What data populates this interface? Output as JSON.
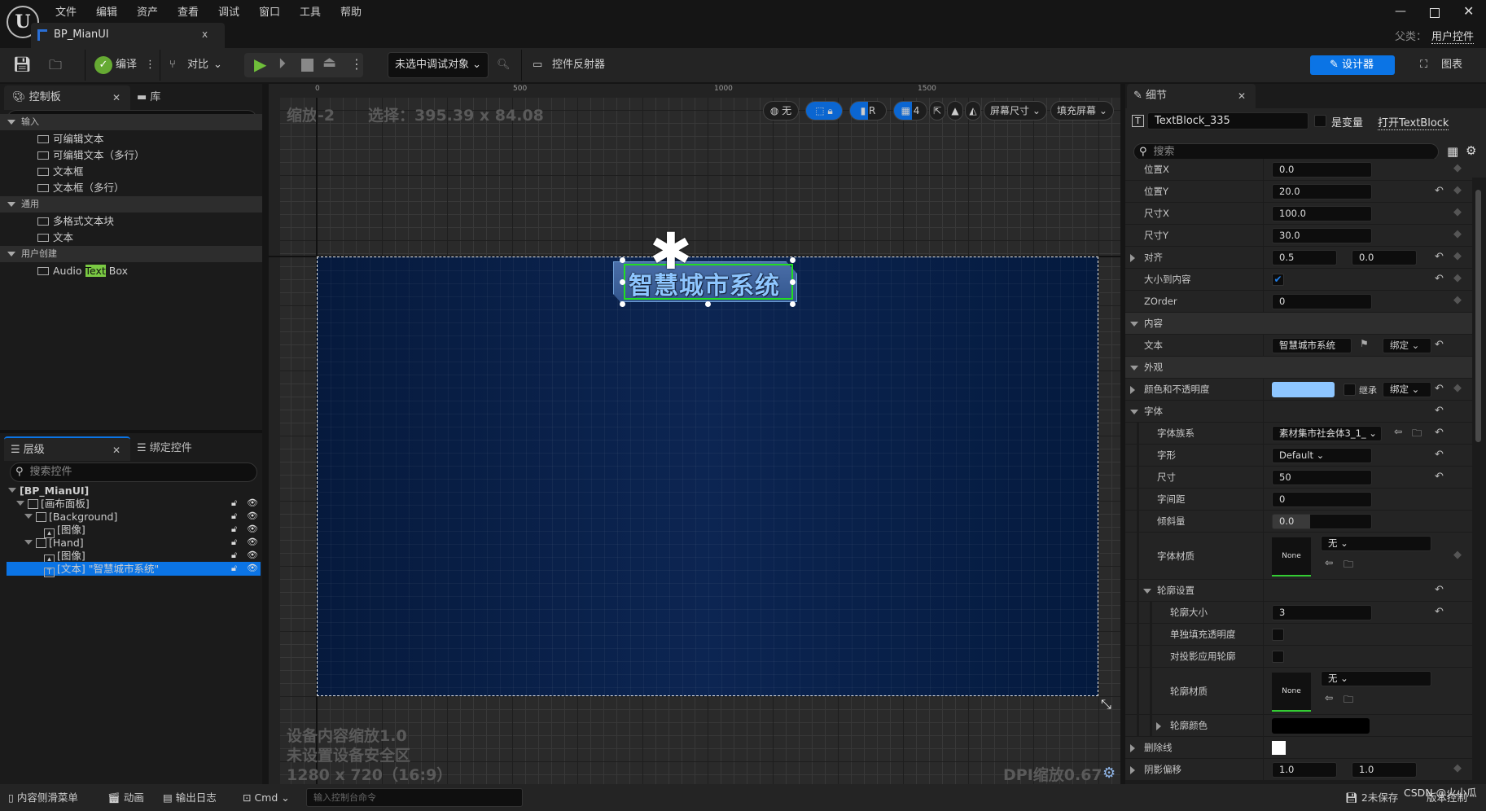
{
  "menu": [
    "文件",
    "编辑",
    "资产",
    "查看",
    "调试",
    "窗口",
    "工具",
    "帮助"
  ],
  "window": {
    "tab_title": "BP_MianUI",
    "parent_label": "父类：",
    "parent_value": "用户控件"
  },
  "toolbar": {
    "compile": "编译",
    "diff": "对比",
    "debug_target": "未选中调试对象",
    "widget_reflector": "控件反射器",
    "designer": "设计器",
    "graph": "图表"
  },
  "palette": {
    "tab": "控制板",
    "library_tab": "库",
    "search_value": "text",
    "categories": [
      {
        "label": "输入",
        "items": [
          "可编辑文本",
          "可编辑文本（多行）",
          "文本框",
          "文本框（多行）"
        ]
      },
      {
        "label": "通用",
        "items": [
          "多格式文本块",
          "文本"
        ]
      },
      {
        "label": "用户创建",
        "items": [
          "Audio Text Box"
        ]
      }
    ],
    "highlight": "Text"
  },
  "hierarchy": {
    "tab": "层级",
    "bind_tab": "绑定控件",
    "search_placeholder": "搜索控件",
    "items": [
      {
        "label": "[BP_MianUI]",
        "depth": 0,
        "icon": "root"
      },
      {
        "label": "[画布面板]",
        "depth": 1,
        "icon": "panel"
      },
      {
        "label": "[Background]",
        "depth": 2,
        "icon": "panel"
      },
      {
        "label": "[图像]",
        "depth": 3,
        "icon": "image"
      },
      {
        "label": "[Hand]",
        "depth": 2,
        "icon": "panel"
      },
      {
        "label": "[图像]",
        "depth": 3,
        "icon": "image"
      },
      {
        "label": "[文本] \"智慧城市系统\"",
        "depth": 3,
        "icon": "text",
        "selected": true
      }
    ]
  },
  "viewport": {
    "zoom": "缩放-2",
    "selection": "选择：395.39 x 84.08",
    "ruler_x": [
      "0",
      "500",
      "1000",
      "1500"
    ],
    "localization": "无",
    "grid_snap": "4",
    "snap_r": "R",
    "screen_size": "屏幕尺寸",
    "fill_screen": "填充屏幕",
    "device_scale": "设备内容缩放1.0",
    "safe_zone": "未设置设备安全区",
    "resolution": "1280 x 720（16:9）",
    "dpi": "DPI缩放0.67",
    "widget_text": "智慧城市系统",
    "widget_text_color": "#8ec6ff"
  },
  "details": {
    "tab": "细节",
    "name": "TextBlock_335",
    "is_variable": "是变量",
    "open_link": "打开TextBlock",
    "search_placeholder": "搜索",
    "rows": [
      {
        "label": "位置X",
        "kind": "field",
        "v": [
          "0.0"
        ],
        "depth": 0,
        "key": true
      },
      {
        "label": "位置Y",
        "kind": "field",
        "v": [
          "20.0"
        ],
        "depth": 0,
        "reset": true,
        "key": true
      },
      {
        "label": "尺寸X",
        "kind": "field",
        "v": [
          "100.0"
        ],
        "depth": 0,
        "key": true
      },
      {
        "label": "尺寸Y",
        "kind": "field",
        "v": [
          "30.0"
        ],
        "depth": 0,
        "key": true
      },
      {
        "label": "对齐",
        "kind": "pair",
        "v": [
          "0.5",
          "0.0"
        ],
        "depth": 0,
        "exp": "closed",
        "reset": true,
        "key": true
      },
      {
        "label": "大小到内容",
        "kind": "check",
        "checked": true,
        "depth": 0,
        "reset": true,
        "key": true
      },
      {
        "label": "ZOrder",
        "kind": "field",
        "v": [
          "0"
        ],
        "depth": 0,
        "key": true
      },
      {
        "label": "内容",
        "kind": "category",
        "depth": 0
      },
      {
        "label": "文本",
        "kind": "text",
        "v": [
          "智慧城市系统",
          "绑定"
        ],
        "depth": 0,
        "reset": true
      },
      {
        "label": "外观",
        "kind": "category",
        "depth": 0
      },
      {
        "label": "颜色和不透明度",
        "kind": "color",
        "color": "#8ec6ff",
        "v": [
          "继承",
          "绑定"
        ],
        "depth": 0,
        "exp": "closed",
        "reset": true,
        "key": true
      },
      {
        "label": "字体",
        "kind": "group",
        "depth": 0,
        "exp": "open",
        "reset": true
      },
      {
        "label": "字体族系",
        "kind": "font",
        "v": [
          "素材集市社会体3_1_"
        ],
        "depth": 1,
        "reset": true
      },
      {
        "label": "字形",
        "kind": "dropdown",
        "v": [
          "Default"
        ],
        "depth": 1,
        "reset": true
      },
      {
        "label": "尺寸",
        "kind": "field",
        "v": [
          "50"
        ],
        "depth": 1,
        "reset": true
      },
      {
        "label": "字间距",
        "kind": "field",
        "v": [
          "0"
        ],
        "depth": 1
      },
      {
        "label": "倾斜量",
        "kind": "slider",
        "v": [
          "0.0"
        ],
        "depth": 1
      },
      {
        "label": "字体材质",
        "kind": "material",
        "v": [
          "None",
          "无"
        ],
        "depth": 1,
        "key": true
      },
      {
        "label": "轮廓设置",
        "kind": "group",
        "depth": 1,
        "exp": "open",
        "reset": true
      },
      {
        "label": "轮廓大小",
        "kind": "field",
        "v": [
          "3"
        ],
        "depth": 2,
        "reset": true
      },
      {
        "label": "单独填充透明度",
        "kind": "check",
        "checked": false,
        "depth": 2
      },
      {
        "label": "对投影应用轮廓",
        "kind": "check",
        "checked": false,
        "depth": 2
      },
      {
        "label": "轮廓材质",
        "kind": "material",
        "v": [
          "None",
          "无"
        ],
        "depth": 2
      },
      {
        "label": "轮廓颜色",
        "kind": "color",
        "color": "#000000",
        "v": [],
        "depth": 2,
        "exp": "closed"
      },
      {
        "label": "删除线",
        "kind": "swatch",
        "color": "#ffffff",
        "depth": 0,
        "exp": "closed"
      },
      {
        "label": "阴影偏移",
        "kind": "pair",
        "v": [
          "1.0",
          "1.0"
        ],
        "depth": 0,
        "exp": "closed",
        "key": true
      }
    ]
  },
  "statusbar": {
    "content_drawer": "内容侧滑菜单",
    "animation": "动画",
    "output_log": "输出日志",
    "cmd": "Cmd",
    "cmd_placeholder": "输入控制台命令",
    "unsaved": "2未保存",
    "source_control": "版本控制",
    "watermark": "CSDN @火小瓜"
  },
  "colors": {
    "accent": "#0b66d1",
    "selection_green": "#22dd22",
    "artboard": "#0b2350"
  }
}
